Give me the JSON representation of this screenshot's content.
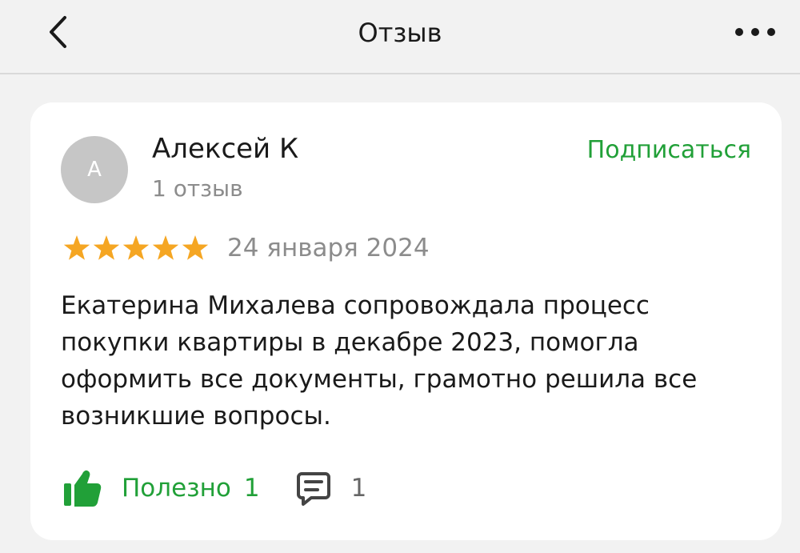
{
  "header": {
    "title": "Отзыв",
    "back_icon": "chevron-left-icon",
    "more_icon": "more-horizontal-icon"
  },
  "review": {
    "author": {
      "initial": "А",
      "name": "Алексей К",
      "reviews_count": "1 отзыв"
    },
    "subscribe_label": "Подписаться",
    "rating": 5,
    "rating_max": 5,
    "date": "24 января 2024",
    "text": "Екатерина Михалева сопровождала процесс покупки квартиры в декабре 2023, помогла оформить все документы, грамотно решила все возникшие вопросы.",
    "helpful_label": "Полезно",
    "helpful_count": "1",
    "comments_count": "1"
  },
  "colors": {
    "accent": "#21a038",
    "star": "#f5a623",
    "muted_text": "#8c8c8c",
    "avatar_bg": "#c6c6c6",
    "background": "#f2f2f2",
    "card": "#ffffff"
  }
}
